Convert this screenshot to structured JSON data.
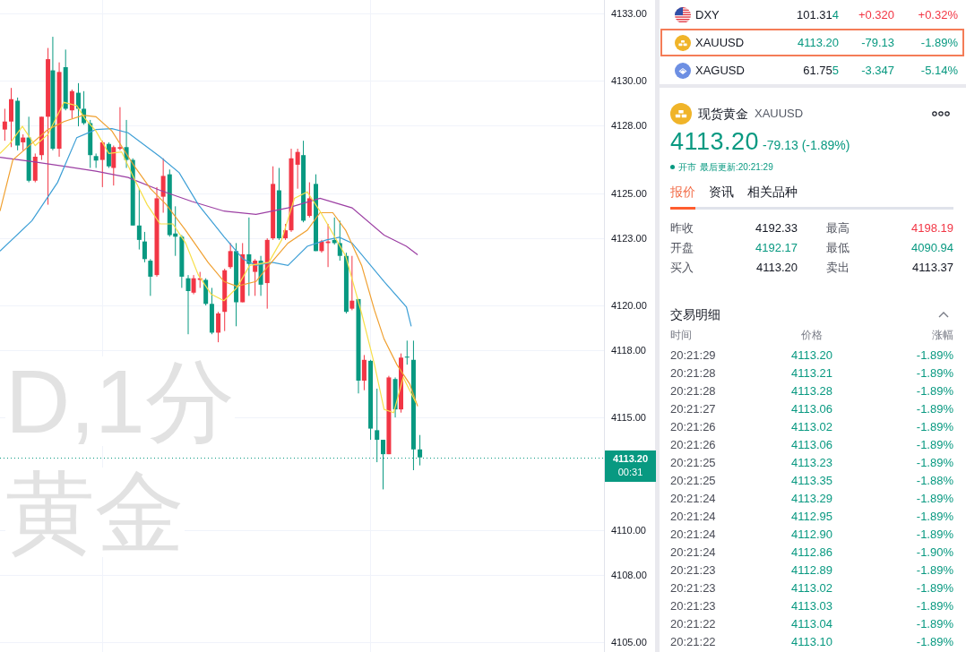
{
  "chart": {
    "watermark_lines": [
      "D,1分",
      "黄金"
    ],
    "price_axis": {
      "labels": [
        "4133.00",
        "4130.00",
        "4128.00",
        "4125.00",
        "4123.00",
        "4120.00",
        "4118.00",
        "4115.00",
        "4110.00",
        "4108.00",
        "4105.00"
      ],
      "last_price": "4113.20",
      "countdown": "00:31"
    }
  },
  "watchlist": [
    {
      "kind": "index",
      "symbol": "DXY",
      "price_parts": [
        {
          "text": "101.31",
          "color": "#131722"
        },
        {
          "text": "4",
          "color": "#089981"
        }
      ],
      "change": "+0.320",
      "change_pct": "+0.32%",
      "color": "#f23645",
      "selected": false
    },
    {
      "kind": "gold",
      "symbol": "XAUUSD",
      "price_parts": [
        {
          "text": "4113.20",
          "color": "#089981"
        }
      ],
      "change": "-79.13",
      "change_pct": "-1.89%",
      "color": "#089981",
      "selected": true
    },
    {
      "kind": "silver",
      "symbol": "XAGUSD",
      "price_parts": [
        {
          "text": "61.75",
          "color": "#131722"
        },
        {
          "text": "5",
          "color": "#089981"
        }
      ],
      "change": "-3.347",
      "change_pct": "-5.14%",
      "color": "#089981",
      "selected": false
    }
  ],
  "quote": {
    "name": "现货黄金",
    "symbol": "XAUUSD",
    "price": "4113.20",
    "change": "-79.13 (-1.89%)",
    "market_status": "开市",
    "last_update": "最后更新:20:21:29",
    "tabs": [
      {
        "label": "报价",
        "selected": true
      },
      {
        "label": "资讯",
        "selected": false
      },
      {
        "label": "相关品种",
        "selected": false
      }
    ],
    "stats": [
      {
        "label": "昨收",
        "value": "4192.33",
        "color": "#131722"
      },
      {
        "label": "最高",
        "value": "4198.19",
        "color": "#f23645"
      },
      {
        "label": "开盘",
        "value": "4192.17",
        "color": "#089981"
      },
      {
        "label": "最低",
        "value": "4090.94",
        "color": "#089981"
      },
      {
        "label": "买入",
        "value": "4113.20",
        "color": "#131722"
      },
      {
        "label": "卖出",
        "value": "4113.37",
        "color": "#131722"
      }
    ]
  },
  "trades": {
    "title": "交易明细",
    "expanded": true,
    "columns": [
      "时间",
      "价格",
      "涨幅"
    ],
    "rows": [
      {
        "time": "20:21:29",
        "price": "4113.20",
        "change": "-1.89%"
      },
      {
        "time": "20:21:28",
        "price": "4113.21",
        "change": "-1.89%"
      },
      {
        "time": "20:21:28",
        "price": "4113.28",
        "change": "-1.89%"
      },
      {
        "time": "20:21:27",
        "price": "4113.06",
        "change": "-1.89%"
      },
      {
        "time": "20:21:26",
        "price": "4113.02",
        "change": "-1.89%"
      },
      {
        "time": "20:21:26",
        "price": "4113.06",
        "change": "-1.89%"
      },
      {
        "time": "20:21:25",
        "price": "4113.23",
        "change": "-1.89%"
      },
      {
        "time": "20:21:25",
        "price": "4113.35",
        "change": "-1.88%"
      },
      {
        "time": "20:21:24",
        "price": "4113.29",
        "change": "-1.89%"
      },
      {
        "time": "20:21:24",
        "price": "4112.95",
        "change": "-1.89%"
      },
      {
        "time": "20:21:24",
        "price": "4112.90",
        "change": "-1.89%"
      },
      {
        "time": "20:21:24",
        "price": "4112.86",
        "change": "-1.90%"
      },
      {
        "time": "20:21:23",
        "price": "4112.89",
        "change": "-1.89%"
      },
      {
        "time": "20:21:23",
        "price": "4113.02",
        "change": "-1.89%"
      },
      {
        "time": "20:21:23",
        "price": "4113.03",
        "change": "-1.89%"
      },
      {
        "time": "20:21:22",
        "price": "4113.04",
        "change": "-1.89%"
      },
      {
        "time": "20:21:22",
        "price": "4113.10",
        "change": "-1.89%"
      }
    ]
  }
}
